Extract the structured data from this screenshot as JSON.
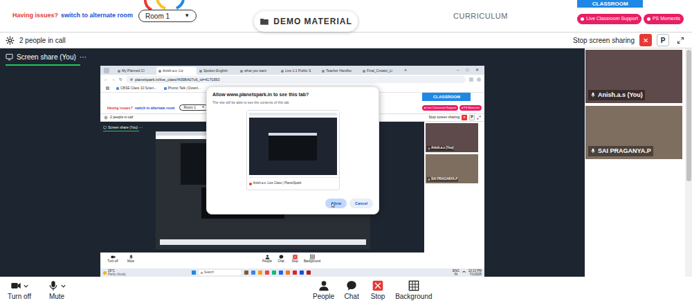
{
  "top_bar": {
    "issue_text": "Having issues?",
    "switch_link": "switch to alternate room",
    "room": "Room 1",
    "room_arrow": "▼",
    "demo_material": "DEMO MATERIAL",
    "curriculum": "CURRICULUM",
    "classroom_tab": "CLASSROOM",
    "buttons": [
      "Live Classroom Support",
      "PS Moments"
    ]
  },
  "call_bar": {
    "people": "2 people in call",
    "stop_sharing": "Stop screen sharing",
    "close": "✕",
    "p": "P"
  },
  "screen_share": {
    "label": "Screen share (You)",
    "menu": "···"
  },
  "participants": [
    {
      "name": "Anish.a.s (You)"
    },
    {
      "name": "SAI PRAGANYA.P"
    }
  ],
  "controls": {
    "left": [
      {
        "label": "Turn off"
      },
      {
        "label": "Mute"
      }
    ],
    "center": [
      {
        "label": "People",
        "active": false
      },
      {
        "label": "Chat",
        "active": false
      },
      {
        "label": "Stop",
        "active": true
      },
      {
        "label": "Background",
        "active": false
      }
    ]
  },
  "shared": {
    "tabs": [
      {
        "label": "My Planned Cl",
        "selected": false
      },
      {
        "label": "Anish.a.s: Liv",
        "selected": true
      },
      {
        "label": "Spoken English",
        "selected": false
      },
      {
        "label": "what you want",
        "selected": false
      },
      {
        "label": "Live 1:1 Public S",
        "selected": false
      },
      {
        "label": "Teacher Handbo",
        "selected": false
      },
      {
        "label": "Final_Creator_Li",
        "selected": false
      }
    ],
    "new_tab": "+",
    "window_controls": [
      "–",
      "□",
      "✕"
    ],
    "nav": [
      "←",
      "→",
      "↻"
    ],
    "url": "planetspark.in/live_class/f4398A07c6_id=4170350",
    "bookmarks": [
      "CBSE Class 10 Scien...",
      "Phonic Talk | Downl..."
    ],
    "page": {
      "top_bar": {
        "issue_text": "Having issues?",
        "switch_link": "switch to alternate room",
        "room": "Room 1",
        "room_arrow": "▼",
        "classroom_tab": "CLASSROOM",
        "buttons": [
          "Live Classroom Support",
          "PS Moments"
        ]
      },
      "call_bar": {
        "people": "2 people in call",
        "stop_sharing": "Stop screen sharing",
        "close": "✕",
        "p": "P"
      },
      "screen_share": {
        "label": "Screen share (You)",
        "menu": "···"
      },
      "participants": [
        {
          "name": "Anish.a.s (You)"
        },
        {
          "name": "SAI PRAGANYA.P"
        }
      ],
      "controls": {
        "left": [
          {
            "label": "Turn off"
          },
          {
            "label": "Mute"
          }
        ],
        "center": [
          {
            "label": "People",
            "active": false
          },
          {
            "label": "Chat",
            "active": false
          },
          {
            "label": "Stop",
            "active": true
          },
          {
            "label": "Background",
            "active": false
          }
        ]
      }
    },
    "dialog": {
      "title": "Allow www.planetspark.in to see this tab?",
      "subtitle": "The site will be able to see the contents of this tab",
      "caption": "Anish.a.s: Live Class | PlanetSpark",
      "buttons": [
        {
          "label": "Allow",
          "selected": true
        },
        {
          "label": "Cancel",
          "selected": false
        }
      ]
    },
    "taskbar": {
      "temp": "29°C",
      "weather": "Partly cloudy",
      "search": "Search",
      "lang": "ENG",
      "region": "IN",
      "time": "10:13 PM",
      "date": "7/1/2025"
    }
  }
}
